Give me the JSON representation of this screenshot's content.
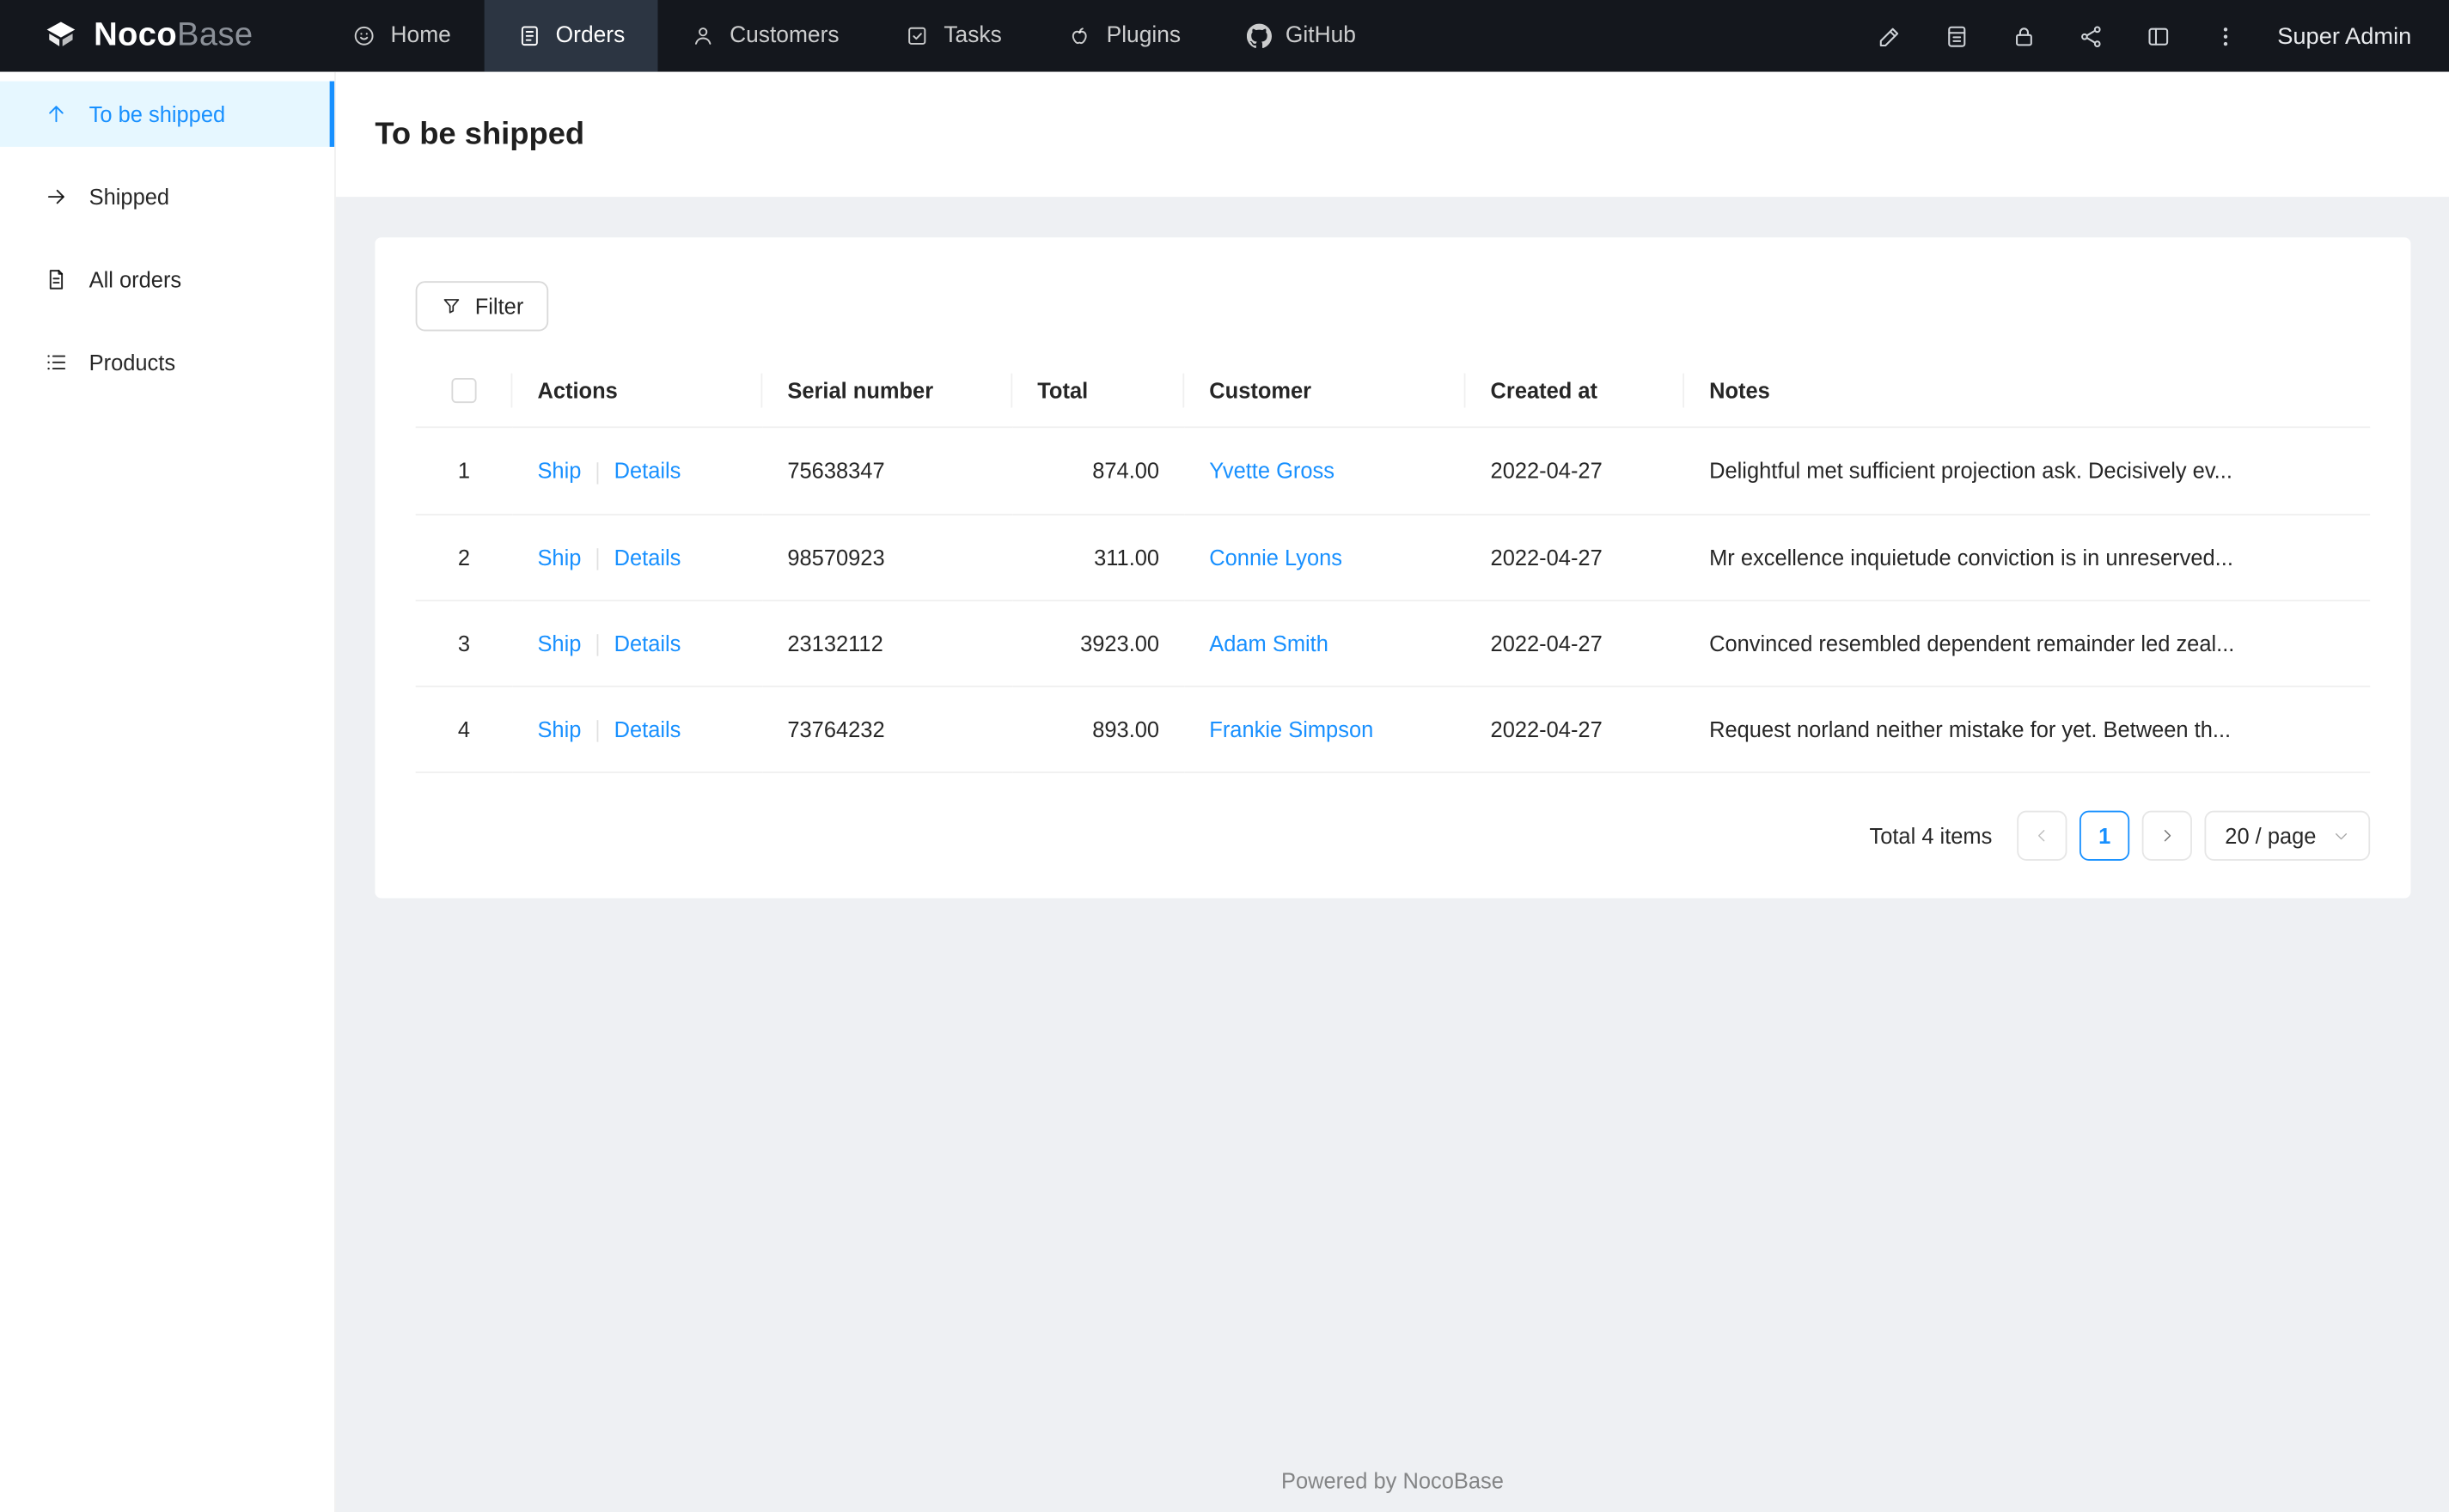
{
  "colors": {
    "accent": "#1890ff",
    "navbar_bg": "#14171d",
    "navbar_active_bg": "#2c3542",
    "sidebar_active_bg": "#e6f7ff",
    "content_bg": "#eef0f3",
    "border": "#f0f0f0"
  },
  "navbar": {
    "logo_primary": "Noco",
    "logo_secondary": "Base",
    "items": [
      {
        "label": "Home",
        "icon": "home-icon",
        "active": false
      },
      {
        "label": "Orders",
        "icon": "orders-icon",
        "active": true
      },
      {
        "label": "Customers",
        "icon": "customers-icon",
        "active": false
      },
      {
        "label": "Tasks",
        "icon": "tasks-icon",
        "active": false
      },
      {
        "label": "Plugins",
        "icon": "plugins-icon",
        "active": false
      },
      {
        "label": "GitHub",
        "icon": "github-icon",
        "active": false
      }
    ],
    "right_icons": [
      "pen-icon",
      "notebook-icon",
      "lock-icon",
      "nodes-icon",
      "layout-icon",
      "more-icon"
    ],
    "user_label": "Super Admin"
  },
  "sidebar": {
    "items": [
      {
        "label": "To be shipped",
        "icon": "arrow-up-icon",
        "active": true
      },
      {
        "label": "Shipped",
        "icon": "arrow-right-icon",
        "active": false
      },
      {
        "label": "All orders",
        "icon": "document-icon",
        "active": false
      },
      {
        "label": "Products",
        "icon": "list-icon",
        "active": false
      }
    ]
  },
  "page": {
    "title": "To be shipped"
  },
  "toolbar": {
    "filter_label": "Filter"
  },
  "table": {
    "columns": [
      "Actions",
      "Serial number",
      "Total",
      "Customer",
      "Created at",
      "Notes"
    ],
    "row_actions": [
      "Ship",
      "Details"
    ],
    "rows": [
      {
        "index": "1",
        "serial": "75638347",
        "total": "874.00",
        "customer": "Yvette Gross",
        "created_at": "2022-04-27",
        "notes": "Delightful met sufficient projection ask. Decisively ev..."
      },
      {
        "index": "2",
        "serial": "98570923",
        "total": "311.00",
        "customer": "Connie Lyons",
        "created_at": "2022-04-27",
        "notes": "Mr excellence inquietude conviction is in unreserved..."
      },
      {
        "index": "3",
        "serial": "23132112",
        "total": "3923.00",
        "customer": "Adam Smith",
        "created_at": "2022-04-27",
        "notes": "Convinced resembled dependent remainder led zeal..."
      },
      {
        "index": "4",
        "serial": "73764232",
        "total": "893.00",
        "customer": "Frankie Simpson",
        "created_at": "2022-04-27",
        "notes": "Request norland neither mistake for yet. Between th..."
      }
    ]
  },
  "pagination": {
    "total_text": "Total 4 items",
    "current_page": "1",
    "page_size_label": "20 / page"
  },
  "footer": {
    "text": "Powered by NocoBase"
  }
}
